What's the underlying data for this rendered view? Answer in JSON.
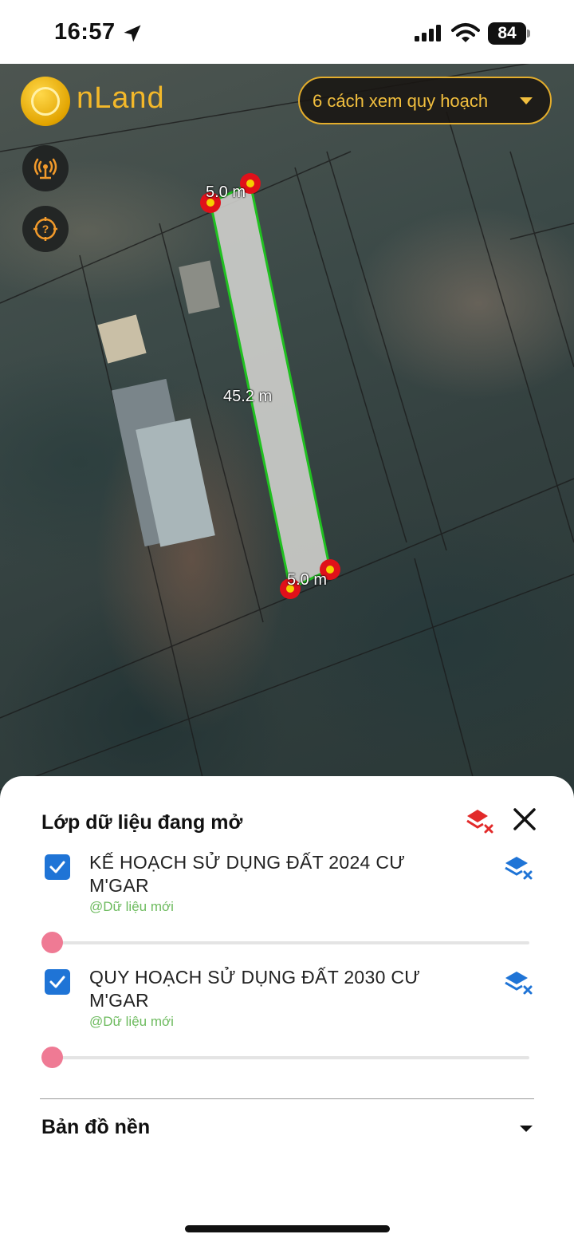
{
  "status_bar": {
    "time": "16:57",
    "battery": "84",
    "icons": [
      "location-arrow-icon",
      "signal-icon",
      "wifi-icon",
      "battery-icon"
    ]
  },
  "map": {
    "logo_text": "nLand",
    "plan_button_label": "6 cách xem quy hoạch",
    "side_buttons": [
      "broadcast-icon",
      "help-icon"
    ],
    "measurements": {
      "top_edge": "5.0 m",
      "long_edge": "45.2 m",
      "bottom_edge": "5.0 m"
    },
    "colors": {
      "accent": "#f3b82a",
      "parcel_outline": "#20c020",
      "vertex": "#e0101a"
    }
  },
  "sheet": {
    "title": "Lớp dữ liệu đang mở",
    "layers": [
      {
        "name": "KẾ HOẠCH SỬ DỤNG ĐẤT 2024 CƯ M'GAR",
        "source": "@Dữ liệu mới",
        "checked": true,
        "opacity": 0
      },
      {
        "name": "QUY HOẠCH SỬ DỤNG ĐẤT 2030 CƯ M'GAR",
        "source": "@Dữ liệu mới",
        "checked": true,
        "opacity": 0
      }
    ],
    "basemap_label": "Bản đồ nền",
    "colors": {
      "checkbox": "#1f74d6",
      "source_text": "#6dbb5e",
      "slider_thumb": "#ef7a94",
      "clear_icon": "#e22a2a"
    }
  }
}
